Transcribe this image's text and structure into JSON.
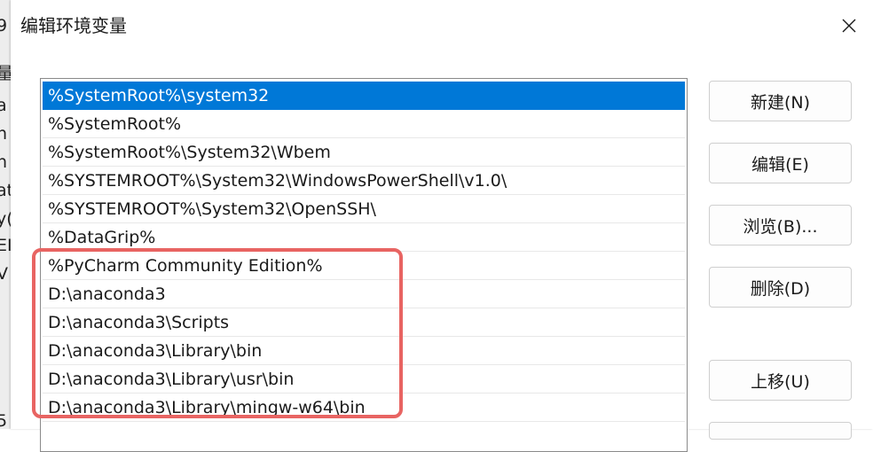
{
  "background_window": {
    "visible_glyphs": [
      "9",
      "量",
      "a",
      "n",
      "n",
      "at",
      "y(",
      "EI",
      "V",
      "5"
    ]
  },
  "dialog": {
    "title": "编辑环境变量",
    "close_icon": "close-icon"
  },
  "path_list": {
    "selected_index": 0,
    "items": [
      "%SystemRoot%\\system32",
      "%SystemRoot%",
      "%SystemRoot%\\System32\\Wbem",
      "%SYSTEMROOT%\\System32\\WindowsPowerShell\\v1.0\\",
      "%SYSTEMROOT%\\System32\\OpenSSH\\",
      "%DataGrip%",
      "%PyCharm Community Edition%",
      "D:\\anaconda3",
      "D:\\anaconda3\\Scripts",
      "D:\\anaconda3\\Library\\bin",
      "D:\\anaconda3\\Library\\usr\\bin",
      "D:\\anaconda3\\Library\\mingw-w64\\bin"
    ],
    "highlight_color": "#e86462",
    "selection_color": "#0078d7"
  },
  "buttons": {
    "new": "新建(N)",
    "edit": "编辑(E)",
    "browse": "浏览(B)...",
    "delete": "删除(D)",
    "move_up": "上移(U)"
  }
}
